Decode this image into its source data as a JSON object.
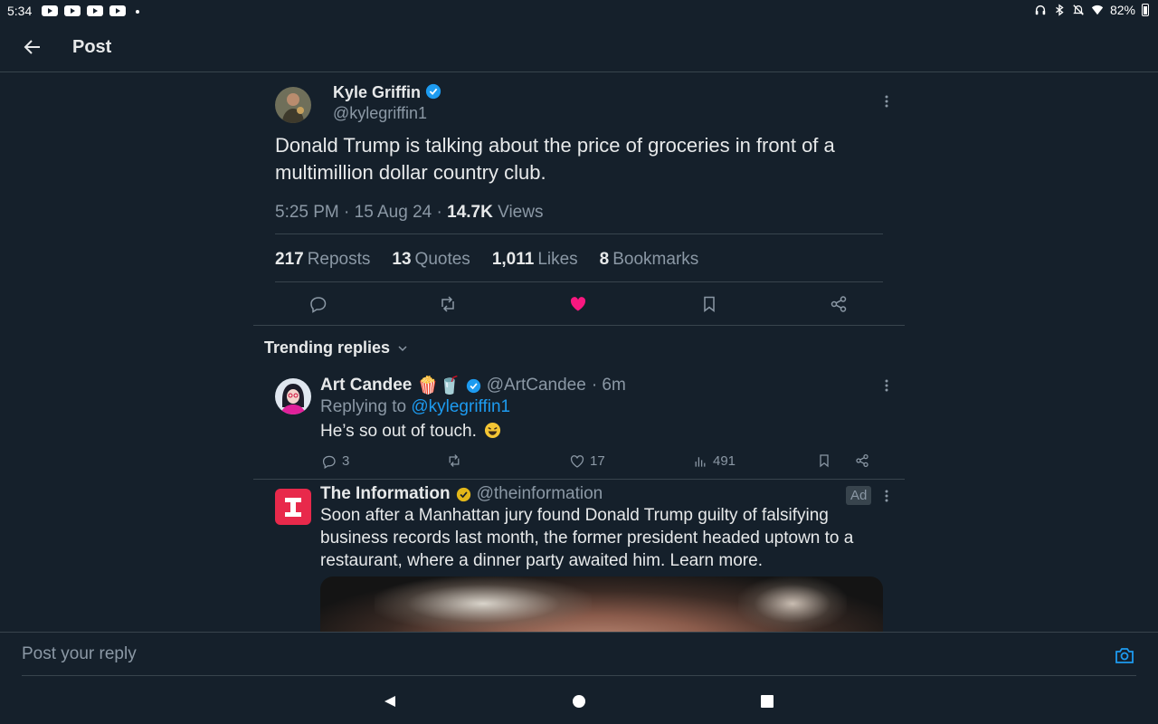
{
  "status_bar": {
    "time": "5:34",
    "battery": "82%"
  },
  "header": {
    "title": "Post"
  },
  "main_tweet": {
    "name": "Kyle Griffin",
    "handle": "@kylegriffin1",
    "text": "Donald Trump is talking about the price of groceries in front of a multimillion dollar country club.",
    "time": "5:25 PM · 15 Aug 24 · ",
    "views_count": "14.7K",
    "views_label": "Views",
    "stats": {
      "reposts_count": "217",
      "reposts_label": "Reposts",
      "quotes_count": "13",
      "quotes_label": "Quotes",
      "likes_count": "1,011",
      "likes_label": "Likes",
      "bookmarks_count": "8",
      "bookmarks_label": "Bookmarks"
    },
    "liked": true
  },
  "trending": {
    "label": "Trending replies"
  },
  "reply": {
    "name": "Art Candee",
    "emoji": "🍿🥤",
    "handle": "@ArtCandee",
    "time": "· 6m",
    "replying_prefix": "Replying to ",
    "replying_handle": "@kylegriffin1",
    "text": "He’s so out of touch.",
    "replies": "3",
    "likes": "17",
    "views": "491"
  },
  "ad": {
    "name": "The Information",
    "handle": "@theinformation",
    "badge": "Ad",
    "logo_letter": "I",
    "text": "Soon after a Manhattan jury found Donald Trump guilty of falsifying business records last month, the former president headed uptown to a restaurant, where a dinner party awaited him. Learn more."
  },
  "reply_bar": {
    "placeholder": "Post your reply"
  },
  "colors": {
    "background": "#15202b",
    "accent": "#1d9bf0",
    "like": "#f91880",
    "muted": "#8b98a5",
    "divider": "#38444d",
    "gold_badge": "#e2b719",
    "ad_logo": "#e8294b"
  }
}
